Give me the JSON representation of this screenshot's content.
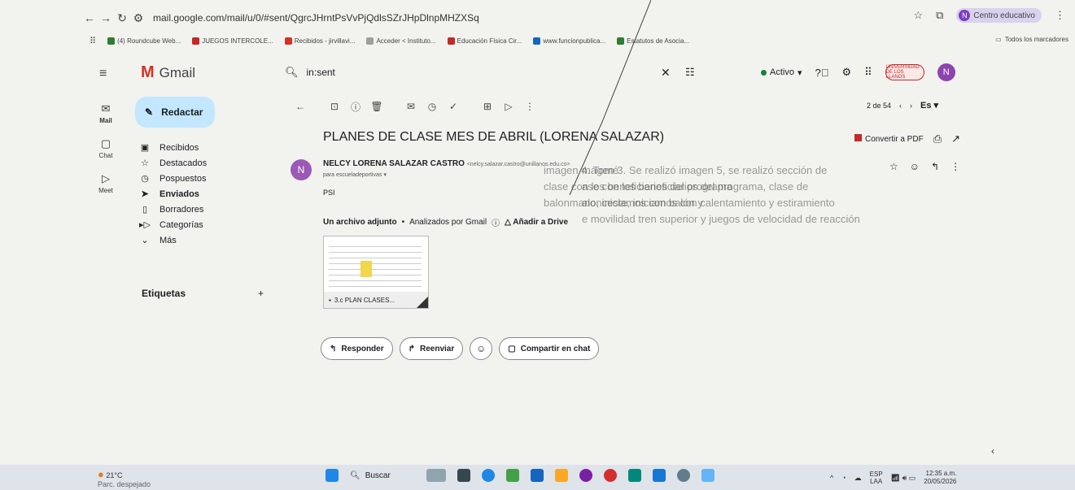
{
  "browser": {
    "url": "mail.google.com/mail/u/0/#sent/QgrcJHrntPsVvPjQdlsSZrJHpDlnpMHZXSq",
    "profile_label": "Centro educativo",
    "profile_initial": "N",
    "bookmarks": [
      {
        "label": "(4) Roundcube Web...",
        "color": "#2e7d32"
      },
      {
        "label": "JUEGOS INTERCOLE...",
        "color": "#c62828"
      },
      {
        "label": "Recibidos - jirvillavi...",
        "color": "#d93025"
      },
      {
        "label": "Acceder < Instituto...",
        "color": "#9e9e9e"
      },
      {
        "label": "Educación Física Cir...",
        "color": "#c62828"
      },
      {
        "label": "www.funcionpublica...",
        "color": "#1565c0"
      },
      {
        "label": "Estatutos de Asocia...",
        "color": "#2e7d32"
      }
    ],
    "all_bookmarks": "Todos los marcadores"
  },
  "gmail": {
    "app_name": "Gmail",
    "search_value": "in:sent",
    "status": "Activo",
    "user_initial": "N",
    "org_badge": "UNIVERSIDAD DE LOS LLANOS"
  },
  "rail": [
    {
      "label": "Mail",
      "icon": "mail-icon"
    },
    {
      "label": "Chat",
      "icon": "chat-icon"
    },
    {
      "label": "Meet",
      "icon": "meet-icon"
    }
  ],
  "compose_label": "Redactar",
  "folders": [
    {
      "label": "Recibidos",
      "icon": "inbox-icon"
    },
    {
      "label": "Destacados",
      "icon": "star-icon"
    },
    {
      "label": "Pospuestos",
      "icon": "clock-icon"
    },
    {
      "label": "Enviados",
      "icon": "send-icon"
    },
    {
      "label": "Borradores",
      "icon": "draft-icon"
    },
    {
      "label": "Categorías",
      "icon": "label-icon"
    },
    {
      "label": "Más",
      "icon": "chevron-down-icon"
    }
  ],
  "labels_title": "Etiquetas",
  "pager": {
    "text": "2 de 54",
    "lang": "Es"
  },
  "message": {
    "subject": "PLANES DE CLASE MES DE ABRIL (LORENA SALAZAR)",
    "convert_pdf": "Convertir a PDF",
    "sender_name": "NELCY LORENA SALAZAR CASTRO",
    "sender_email": "<nelcy.salazar.castro@unillanos.edu.co>",
    "sender_initial": "N",
    "to": "para escueladeportivas",
    "body": "PSI",
    "attachment_header": "Un archivo adjunto",
    "scanned": "Analizados por Gmail",
    "add_drive": "Añadir a Drive",
    "attachment_name": "3.c PLAN CLASES..."
  },
  "actions": {
    "reply": "Responder",
    "forward": "Reenviar",
    "share_chat": "Compartir en chat"
  },
  "overlay_text": {
    "left": [
      "imagen 4. Tomé",
      "clase con los beneficiarios del programa",
      "balonmano, iniciamos con balón y"
    ],
    "right": [
      "magen 3. Se realizó imagen 5, se realizó sección de",
      "ase con los beneficiarios del programa, clase de",
      "alonceste, iniciamos con calentamiento y estiramiento",
      "e movilidad tren superior y juegos de velocidad de reacción"
    ]
  },
  "taskbar": {
    "temp": "21°C",
    "weather": "Parc. despejado",
    "search": "Buscar",
    "lang": "ESP",
    "lang_sub": "LAA",
    "time": "12:35 a.m.",
    "date": "20/05/2026"
  }
}
